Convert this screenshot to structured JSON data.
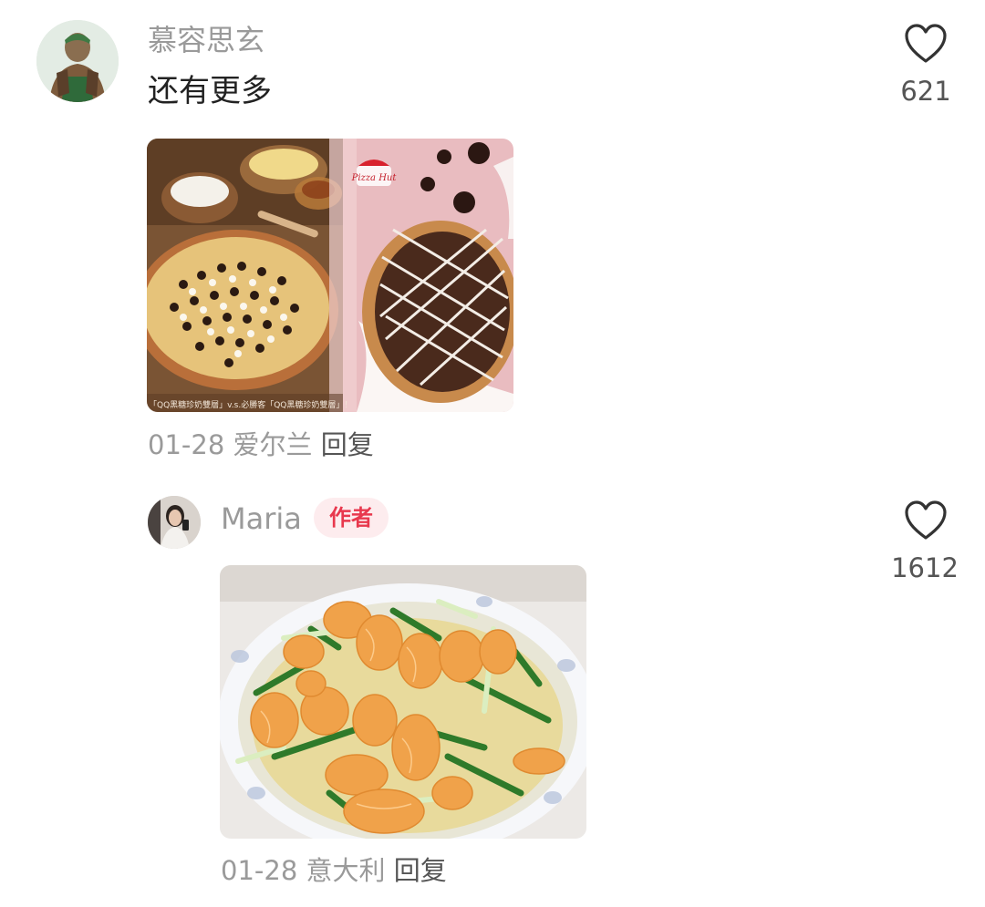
{
  "comments": [
    {
      "username": "慕容思玄",
      "text": "还有更多",
      "likes": "621",
      "date": "01-28",
      "location": "爱尔兰",
      "reply_label": "回复",
      "image_caption": "「QQ黑糖珍奶雙層」v.s.必勝客「QQ黑糖珍奶雙層」！",
      "brand_logo_text": "Pizza Hut"
    },
    {
      "username": "Maria",
      "author_badge": "作者",
      "likes": "1612",
      "date": "01-28",
      "location": "意大利",
      "reply_label": "回复"
    }
  ],
  "colors": {
    "username": "#9a9a9a",
    "text": "#222222",
    "badge_text": "#e8384d",
    "badge_bg": "#fdecee",
    "like_count": "#555555"
  },
  "icons": {
    "like": "heart-outline-icon"
  }
}
